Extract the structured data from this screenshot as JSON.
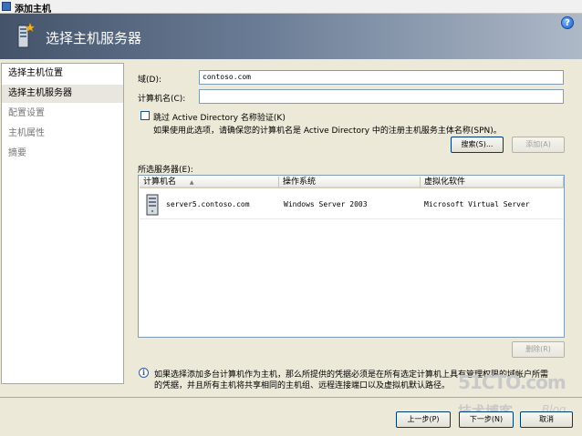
{
  "window": {
    "title": "添加主机"
  },
  "header": {
    "title": "选择主机服务器",
    "help_glyph": "?"
  },
  "nav": {
    "items": [
      {
        "label": "选择主机位置",
        "state": "done"
      },
      {
        "label": "选择主机服务器",
        "state": "current"
      },
      {
        "label": "配置设置",
        "state": "pending"
      },
      {
        "label": "主机属性",
        "state": "pending"
      },
      {
        "label": "摘要",
        "state": "pending"
      }
    ]
  },
  "form": {
    "domain_label": "域(D):",
    "domain_value": "contoso.com",
    "computer_label": "计算机名(C):",
    "computer_value": "",
    "skip_ad_label": "跳过 Active Directory 名称验证(K)",
    "skip_ad_checked": false,
    "skip_ad_note": "如果使用此选项，请确保您的计算机名是 Active Directory 中的注册主机服务主体名称(SPN)。",
    "search_button": "搜索(S)...",
    "add_button": "添加(A)"
  },
  "server_list": {
    "label": "所选服务器(E):",
    "columns": [
      "计算机名",
      "操作系统",
      "虚拟化软件"
    ],
    "sort_glyph": "▲",
    "rows": [
      {
        "name": "server5.contoso.com",
        "os": "Windows Server 2003",
        "virtualization": "Microsoft Virtual Server"
      }
    ],
    "remove_button": "删除(R)"
  },
  "info": {
    "glyph": "i",
    "line1": "如果选择添加多台计算机作为主机，那么所提供的凭据必须是在所有选定计算机上具有管理权限的域帐户所需",
    "line2": "的凭据，并且所有主机将共享相同的主机组、远程连接端口以及虚拟机默认路径。"
  },
  "footer": {
    "prev_button": "上一步(P)",
    "next_button": "下一步(N)",
    "cancel_button": "取消"
  },
  "watermark": {
    "line1": "51CTO.com",
    "line2": "技术博客",
    "line3": "Blog"
  },
  "colors": {
    "accent": "#003c74",
    "header_start": "#44536a",
    "header_end": "#aeb9c8",
    "watermark": "#c9c9c9"
  }
}
